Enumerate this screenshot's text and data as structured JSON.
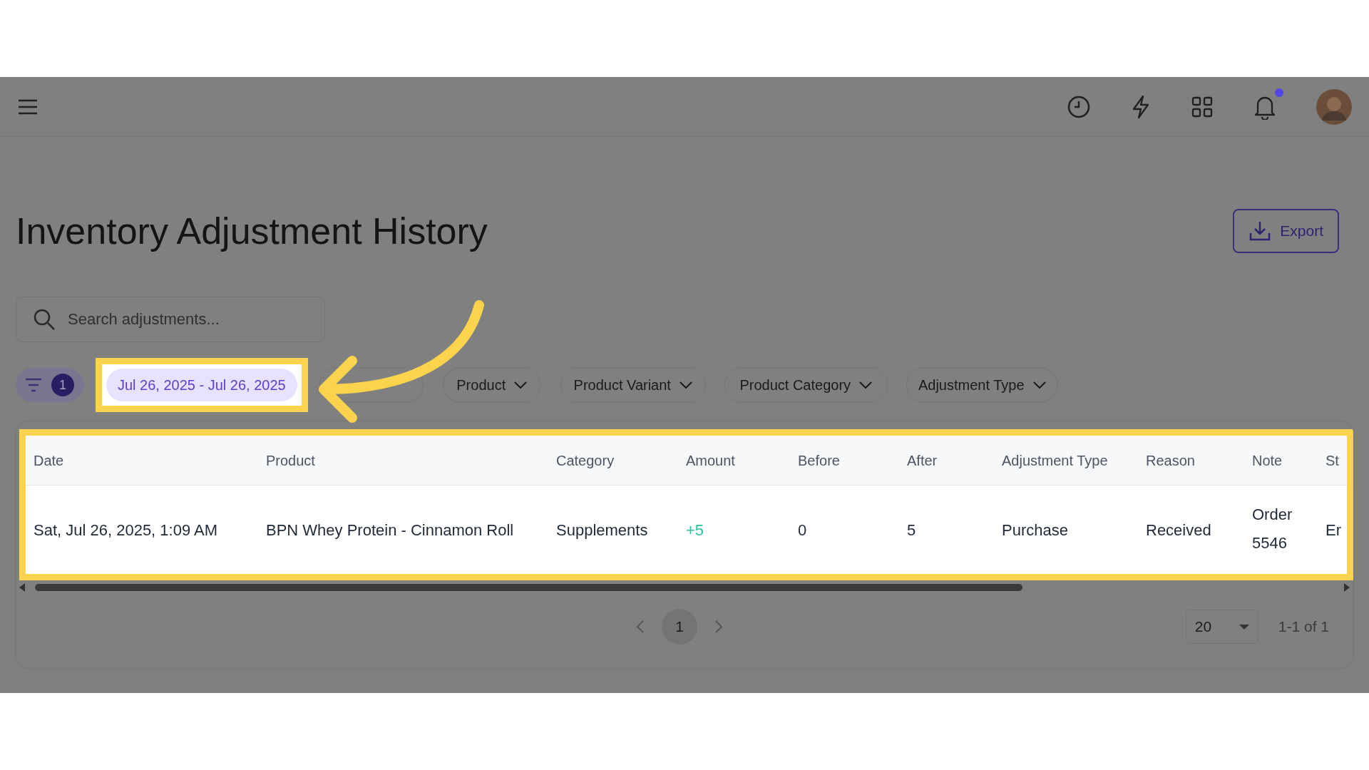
{
  "header": {
    "notifications_unread": true
  },
  "page": {
    "title": "Inventory Adjustment History",
    "export_label": "Export"
  },
  "search": {
    "placeholder": "Search adjustments..."
  },
  "filters": {
    "active_count": "1",
    "date_range": "Jul 26, 2025 - Jul 26, 2025",
    "highlighted": true,
    "chips": [
      {
        "kind": "covered"
      },
      {
        "kind": "dropdown",
        "label": "Product"
      },
      {
        "kind": "dropdown",
        "label": "Product Variant"
      },
      {
        "kind": "dropdown",
        "label": "Product Category"
      },
      {
        "kind": "dropdown",
        "label": "Adjustment Type"
      }
    ]
  },
  "table": {
    "highlighted": true,
    "columns": [
      "Date",
      "Product",
      "Category",
      "Amount",
      "Before",
      "After",
      "Adjustment Type",
      "Reason",
      "Note",
      "St"
    ],
    "rows": [
      {
        "cells": [
          "Sat, Jul 26, 2025, 1:09 AM",
          "BPN Whey Protein - Cinnamon Roll",
          "Supplements",
          "+5",
          "0",
          "5",
          "Purchase",
          "Received",
          "Order 5546",
          "Er"
        ],
        "amount_positive": true
      }
    ]
  },
  "pagination": {
    "pages": [
      {
        "label": "1",
        "selected": true
      }
    ],
    "page_size": "20",
    "range": "1-1 of 1"
  }
}
